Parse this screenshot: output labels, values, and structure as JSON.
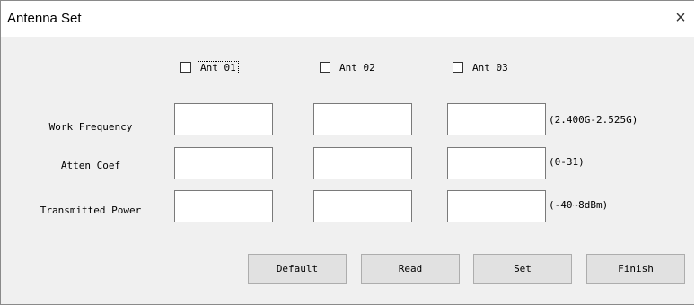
{
  "window": {
    "title": "Antenna Set",
    "close_glyph": "×"
  },
  "antennas": [
    {
      "label": "Ant 01",
      "checked": false
    },
    {
      "label": "Ant 02",
      "checked": false
    },
    {
      "label": "Ant 03",
      "checked": false
    }
  ],
  "rows": [
    {
      "label": "Work Frequency",
      "unit": "(2.400G-2.525G)",
      "values": [
        "",
        "",
        ""
      ]
    },
    {
      "label": "Atten Coef",
      "unit": "(0-31)",
      "values": [
        "",
        "",
        ""
      ]
    },
    {
      "label": "Transmitted Power",
      "unit": "(-40~8dBm)",
      "values": [
        "",
        "",
        ""
      ]
    }
  ],
  "buttons": {
    "default": "Default",
    "read": "Read",
    "set": "Set",
    "finish": "Finish"
  },
  "icons": {
    "close": "close-icon",
    "checkbox": "checkbox-icon"
  }
}
